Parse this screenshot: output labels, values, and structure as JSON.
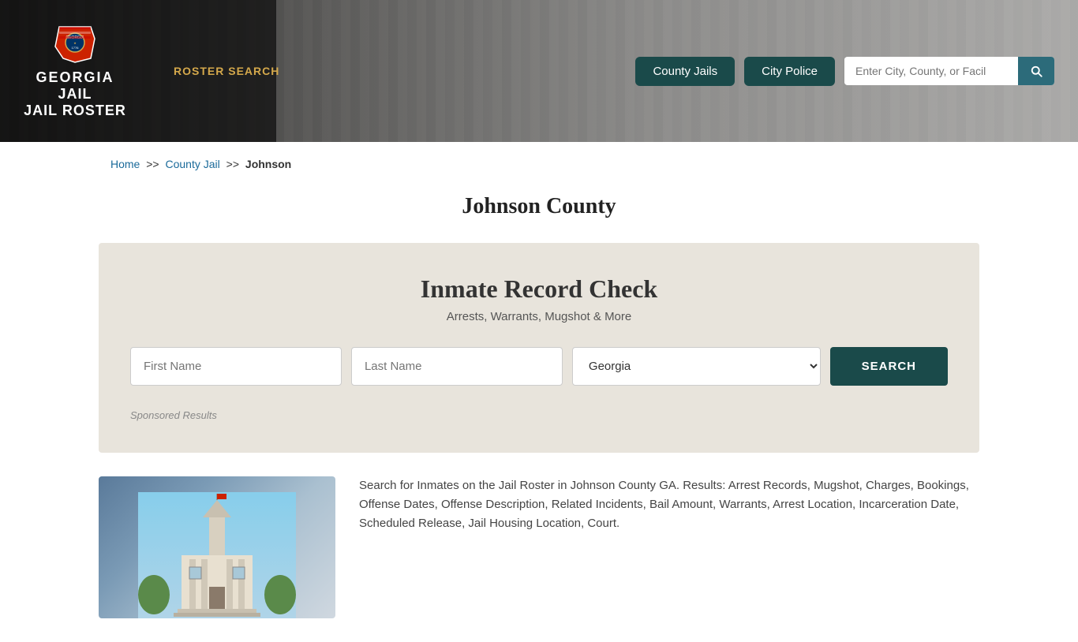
{
  "header": {
    "logo_line1": "GEORGIA",
    "logo_line2": "JAIL ROSTER",
    "nav_link": "ROSTER SEARCH",
    "btn_county_jails": "County Jails",
    "btn_city_police": "City Police",
    "search_placeholder": "Enter City, County, or Facil"
  },
  "breadcrumb": {
    "home": "Home",
    "sep1": ">>",
    "county_jail": "County Jail",
    "sep2": ">>",
    "current": "Johnson"
  },
  "page_title": "Johnson County",
  "record_check": {
    "title": "Inmate Record Check",
    "subtitle": "Arrests, Warrants, Mugshot & More",
    "first_name_placeholder": "First Name",
    "last_name_placeholder": "Last Name",
    "state_default": "Georgia",
    "search_btn": "SEARCH",
    "sponsored_label": "Sponsored Results"
  },
  "bottom": {
    "description": "Search for Inmates on the Jail Roster in Johnson County GA. Results: Arrest Records, Mugshot, Charges, Bookings, Offense Dates, Offense Description, Related Incidents, Bail Amount, Warrants, Arrest Location, Incarceration Date, Scheduled Release, Jail Housing Location, Court."
  }
}
